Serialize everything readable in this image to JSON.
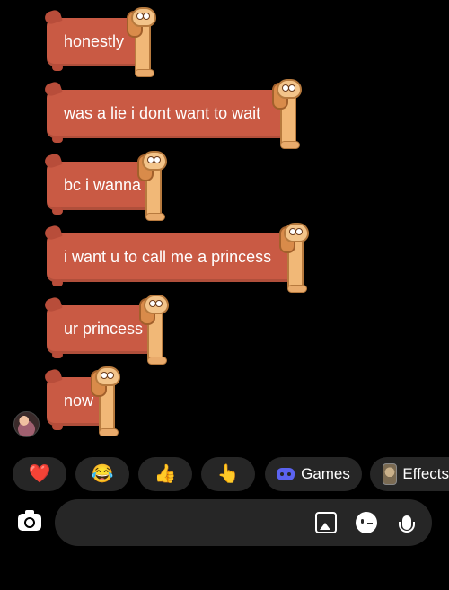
{
  "messages": [
    {
      "text": "honestly"
    },
    {
      "text": "was a lie i dont want to wait"
    },
    {
      "text": "bc i wanna"
    },
    {
      "text": "i want u to call me a princess"
    },
    {
      "text": "ur princess"
    },
    {
      "text": "now"
    }
  ],
  "reactions": [
    {
      "emoji": "❤️",
      "name": "red-heart"
    },
    {
      "emoji": "😂",
      "name": "laughing-tears"
    },
    {
      "emoji": "👍",
      "name": "thumbs-up"
    },
    {
      "emoji": "👆",
      "name": "pointing-hand"
    }
  ],
  "games_label": "Games",
  "effects_label": "Effects",
  "composer": {
    "placeholder": ""
  },
  "colors": {
    "bubble": "#c95a44",
    "background": "#000000",
    "chip": "#262626",
    "games_icon": "#5b63f0"
  }
}
